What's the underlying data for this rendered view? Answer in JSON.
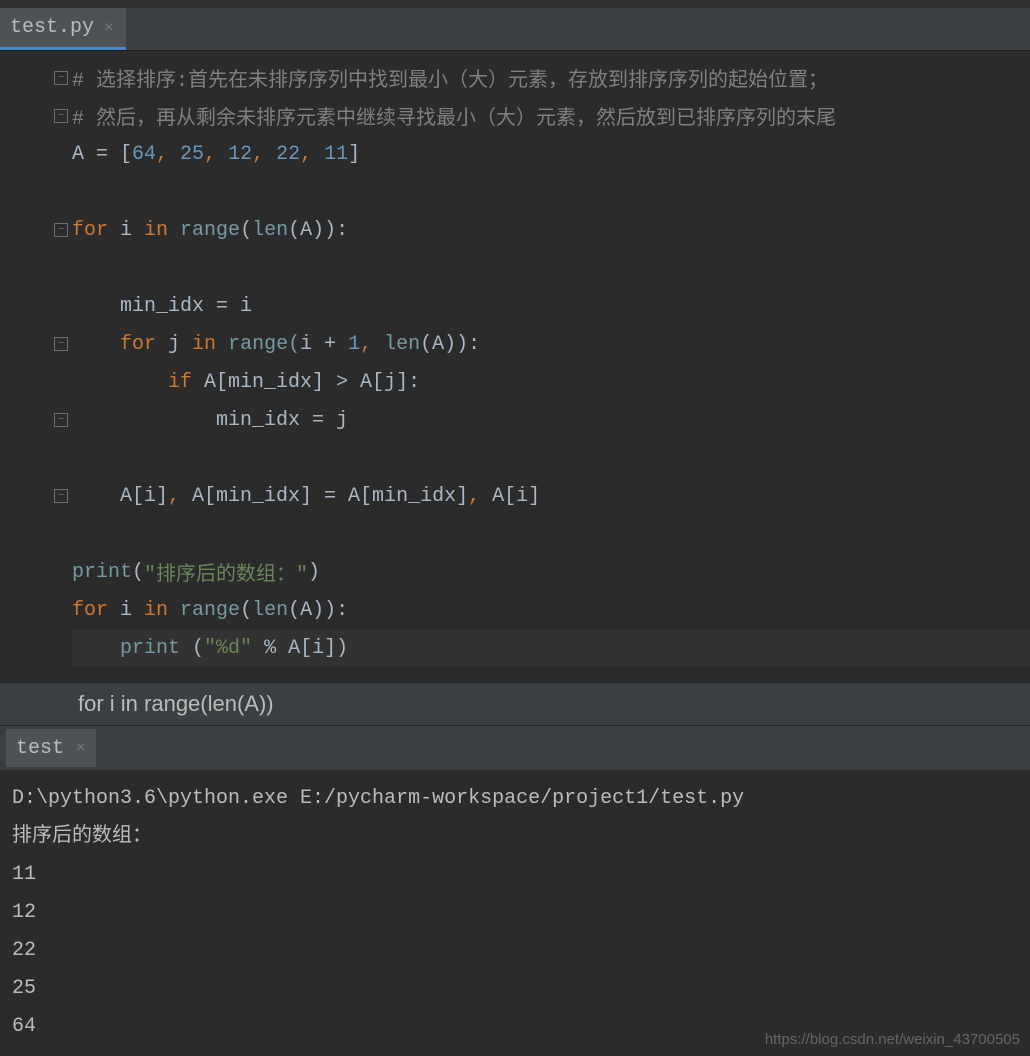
{
  "editor_tab": {
    "filename": "test.py",
    "close": "×"
  },
  "code": {
    "comment1": "# 选择排序:首先在未排序序列中找到最小（大）元素，存放到排序序列的起始位置；",
    "comment2": "# 然后，再从剩余未排序元素中继续寻找最小（大）元素，然后放到已排序序列的末尾",
    "arr_lhs": "A = [",
    "arr_vals": [
      "64",
      "25",
      "12",
      "22",
      "11"
    ],
    "arr_rhs": "]",
    "for_i": "for",
    "i": " i ",
    "in": "in",
    "range": " range",
    "len": "len",
    "lp_A": "(A)):",
    "min_idx_assign": "    min_idx = i",
    "for_j_pre": "    ",
    "for_j": "for",
    "j": " j ",
    "range2_open": " range(",
    "i_plus": "i + ",
    "one": "1",
    "comma": ", ",
    "len2": "len",
    "close2": "(A)):",
    "if": "if",
    "cond": " A[min_idx] > A[j]:",
    "min_idx_j": "            min_idx = j",
    "swap_a": "    A[i]",
    "swap_c1": ", ",
    "swap_b": "A[min_idx] = A[min_idx]",
    "swap_c2": ", ",
    "swap_d": "A[i]",
    "print": "print",
    "print_arg_open": "(",
    "print_str": "\"排序后的数组：\"",
    "print_arg_close": ")",
    "for_i2": "for",
    "i2": " i ",
    "in2": "in",
    "range3": " range",
    "len3": "len",
    "lp_A2": "(A)):",
    "print2_indent": "    ",
    "print2": "print",
    "fmt_open": " (",
    "fmt_str": "\"%d\"",
    "fmt_rest": " % A[i])"
  },
  "context": "for i in range(len(A))",
  "run_tab": {
    "name": "test",
    "close": "×"
  },
  "console": {
    "cmd": "D:\\python3.6\\python.exe E:/pycharm-workspace/project1/test.py",
    "line1": "排序后的数组：",
    "out": [
      "11",
      "12",
      "22",
      "25",
      "64"
    ]
  },
  "watermark": "https://blog.csdn.net/weixin_43700505"
}
